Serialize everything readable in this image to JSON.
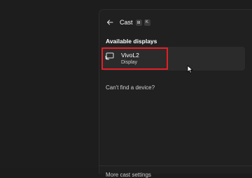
{
  "panel": {
    "title": "Cast",
    "shortcut_keys": [
      "⊞",
      "K"
    ],
    "section_title": "Available displays",
    "devices": [
      {
        "name": "VivoL2",
        "type": "Display",
        "icon": "cast-display-icon"
      }
    ],
    "cant_find_link": "Can't find a device?",
    "more_settings_link": "More cast settings"
  },
  "colors": {
    "panel_bg": "#202020",
    "card_bg": "#2b2b2b",
    "highlight_border": "#e21f26"
  }
}
